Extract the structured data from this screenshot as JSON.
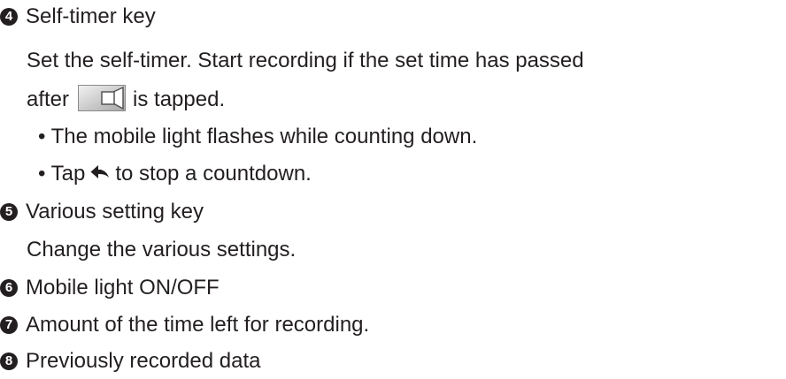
{
  "items": [
    {
      "number": "4",
      "title": "Self-timer key",
      "desc_line1": "Set the self-timer. Start recording if the set time has passed",
      "desc_line2_before": "after",
      "desc_line2_after": "is tapped.",
      "bullets": [
        {
          "text": "• The mobile light flashes while counting down."
        },
        {
          "before": "• Tap",
          "after": "to stop a countdown."
        }
      ]
    },
    {
      "number": "5",
      "title": "Various setting key",
      "desc": "Change the various settings."
    },
    {
      "number": "6",
      "title": "Mobile light ON/OFF"
    },
    {
      "number": "7",
      "title": "Amount of the time left for recording."
    },
    {
      "number": "8",
      "title": "Previously recorded data"
    }
  ],
  "icons": {
    "record_key": "video-camera-key-icon",
    "back_key": "back-arrow-icon"
  }
}
